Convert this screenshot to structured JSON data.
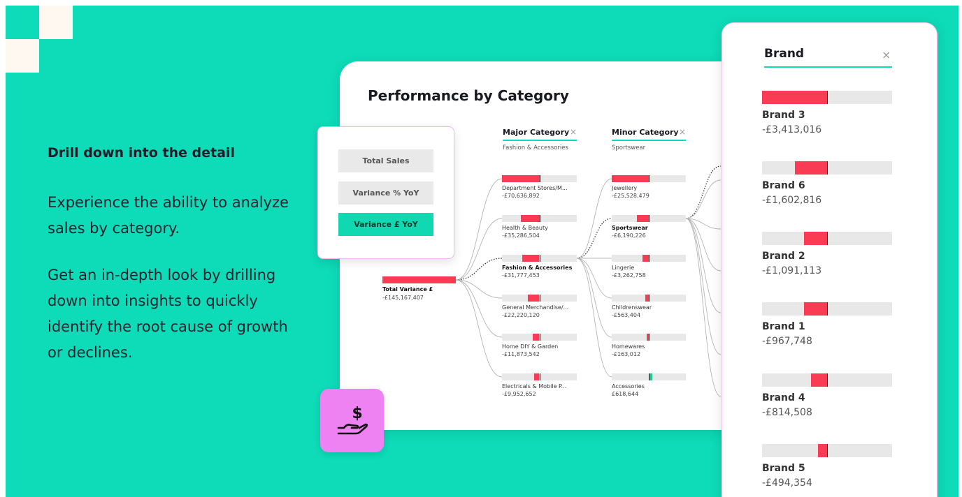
{
  "intro": {
    "heading": "Drill down into the detail",
    "paragraph1": "Experience the ability to analyze sales by category.",
    "paragraph2": "Get an in-depth look by drilling down into insights to quickly identify the root cause of growth or declines."
  },
  "metrics": {
    "options": [
      {
        "label": "Total Sales",
        "active": false
      },
      {
        "label": "Variance % YoY",
        "active": false
      },
      {
        "label": "Variance £ YoY",
        "active": true
      }
    ]
  },
  "card": {
    "title": "Performance by Category",
    "root": {
      "label": "Total Variance £",
      "value": "-£145,167,407",
      "fill_fraction": 1.0
    },
    "major": {
      "header": "Major Category",
      "selected": "Fashion & Accessories",
      "close_icon": "close-icon",
      "nodes": [
        {
          "label": "Department Stores/M...",
          "value": "-£70,636,892",
          "fill_fraction": 1.0,
          "selected": false
        },
        {
          "label": "Health & Beauty",
          "value": "-£35,286,504",
          "fill_fraction": 0.5,
          "selected": false
        },
        {
          "label": "Fashion & Accessories",
          "value": "-£31,777,453",
          "fill_fraction": 0.45,
          "selected": true
        },
        {
          "label": "General Merchandise/...",
          "value": "-£22,220,120",
          "fill_fraction": 0.31,
          "selected": false
        },
        {
          "label": "Home DIY & Garden",
          "value": "-£11,873,542",
          "fill_fraction": 0.17,
          "selected": false
        },
        {
          "label": "Electricals & Mobile P...",
          "value": "-£9,952,652",
          "fill_fraction": 0.14,
          "selected": false
        }
      ]
    },
    "minor": {
      "header": "Minor Category",
      "selected": "Sportswear",
      "close_icon": "close-icon",
      "nodes": [
        {
          "label": "Jewellery",
          "value": "-£25,528,479",
          "fill_fraction": 1.0,
          "selected": false,
          "positive": false
        },
        {
          "label": "Sportswear",
          "value": "-£6,190,226",
          "fill_fraction": 0.33,
          "selected": true,
          "positive": false
        },
        {
          "label": "Lingerie",
          "value": "-£3,262,758",
          "fill_fraction": 0.17,
          "selected": false,
          "positive": false
        },
        {
          "label": "Childrenswear",
          "value": "-£563,404",
          "fill_fraction": 0.09,
          "selected": false,
          "positive": false
        },
        {
          "label": "Homewares",
          "value": "-£163,012",
          "fill_fraction": 0.05,
          "selected": false,
          "positive": false
        },
        {
          "label": "Accessories",
          "value": "£618,644",
          "fill_fraction": 0.09,
          "selected": false,
          "positive": true
        }
      ]
    }
  },
  "brand_panel": {
    "title": "Brand",
    "close_icon": "close-icon",
    "items": [
      {
        "name": "Brand 3",
        "value": "-£3,413,016",
        "fill_fraction": 1.0
      },
      {
        "name": "Brand 6",
        "value": "-£1,602,816",
        "fill_fraction": 0.5
      },
      {
        "name": "Brand 2",
        "value": "-£1,091,113",
        "fill_fraction": 0.36
      },
      {
        "name": "Brand 1",
        "value": "-£967,748",
        "fill_fraction": 0.36
      },
      {
        "name": "Brand 4",
        "value": "-£814,508",
        "fill_fraction": 0.25
      },
      {
        "name": "Brand 5",
        "value": "-£494,354",
        "fill_fraction": 0.14
      }
    ]
  },
  "icons": {
    "money_tile": "money-hand-icon",
    "colors": {
      "negative": "#f93c54",
      "positive": "#20c99a",
      "accent": "#0edbb7",
      "tile": "#ee82f3"
    }
  }
}
